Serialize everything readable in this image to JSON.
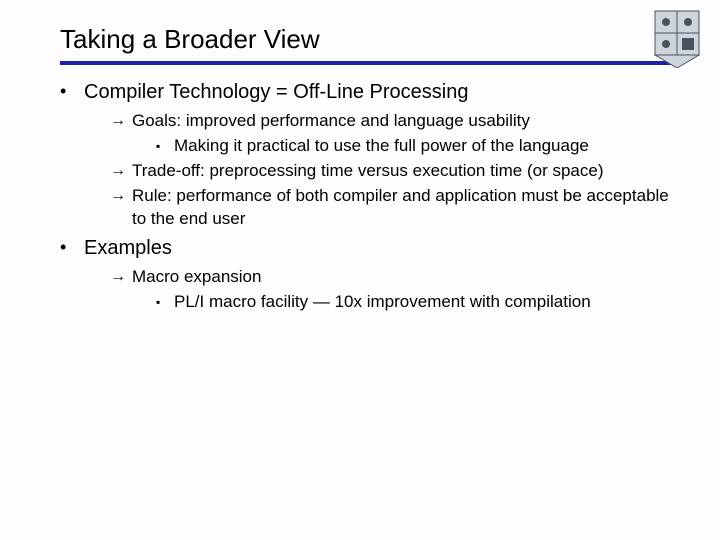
{
  "title": "Taking a Broader View",
  "section1": {
    "heading": "Compiler Technology = Off-Line Processing",
    "items": {
      "goals": "Goals: improved performance and language usability",
      "goals_sub": "Making it practical to use the full power of the language",
      "tradeoff": "Trade-off: preprocessing time versus execution time (or space)",
      "rule": "Rule: performance of both compiler and application must be acceptable to the end user"
    }
  },
  "section2": {
    "heading": "Examples",
    "items": {
      "macro": "Macro expansion",
      "macro_sub": "PL/I macro facility — 10x improvement with compilation"
    }
  }
}
